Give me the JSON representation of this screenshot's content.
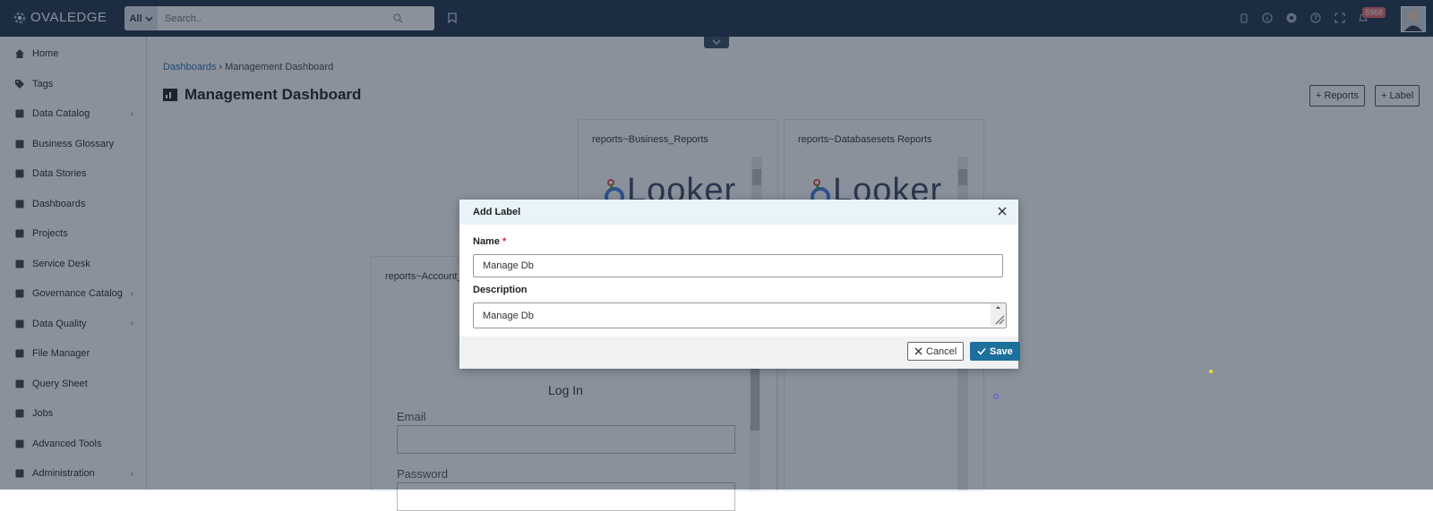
{
  "app": {
    "logo": "OVALEDGE"
  },
  "search": {
    "scope": "All",
    "placeholder": "Search.."
  },
  "notifications": {
    "count": "5968"
  },
  "sidebar": {
    "items": [
      {
        "label": "Home",
        "icon": "home-icon",
        "has_children": false
      },
      {
        "label": "Tags",
        "icon": "tag-icon",
        "has_children": false
      },
      {
        "label": "Data Catalog",
        "icon": "catalog-icon",
        "has_children": true
      },
      {
        "label": "Business Glossary",
        "icon": "glossary-icon",
        "has_children": false
      },
      {
        "label": "Data Stories",
        "icon": "book-icon",
        "has_children": false
      },
      {
        "label": "Dashboards",
        "icon": "dashboard-icon",
        "has_children": false
      },
      {
        "label": "Projects",
        "icon": "projects-icon",
        "has_children": false
      },
      {
        "label": "Service Desk",
        "icon": "service-desk-icon",
        "has_children": false
      },
      {
        "label": "Governance Catalog",
        "icon": "bank-icon",
        "has_children": true
      },
      {
        "label": "Data Quality",
        "icon": "data-quality-icon",
        "has_children": true
      },
      {
        "label": "File Manager",
        "icon": "folder-icon",
        "has_children": false
      },
      {
        "label": "Query Sheet",
        "icon": "query-sheet-icon",
        "has_children": false
      },
      {
        "label": "Jobs",
        "icon": "jobs-icon",
        "has_children": false
      },
      {
        "label": "Advanced Tools",
        "icon": "tools-icon",
        "has_children": false
      },
      {
        "label": "Administration",
        "icon": "admin-icon",
        "has_children": true
      }
    ]
  },
  "breadcrumb": {
    "parent": "Dashboards",
    "current": "Management Dashboard"
  },
  "page": {
    "title": "Management Dashboard",
    "add_reports_label": "Reports",
    "add_label_label": "Label"
  },
  "cards": [
    {
      "title": "reports~Business_Reports",
      "logo_text": "Looker"
    },
    {
      "title": "reports~Databasesets Reports",
      "logo_text": "Looker"
    },
    {
      "title": "reports~Account_R"
    }
  ],
  "login_preview": {
    "title": "Log In",
    "email_label": "Email",
    "password_label": "Password"
  },
  "modal": {
    "title": "Add Label",
    "name_label": "Name",
    "required_mark": "*",
    "name_value": "Manage Db",
    "description_label": "Description",
    "description_value": "Manage Db",
    "cancel_label": "Cancel",
    "save_label": "Save"
  },
  "colors": {
    "topbar": "#22364d",
    "accent": "#1d6f9c",
    "required": "#d9232e"
  }
}
